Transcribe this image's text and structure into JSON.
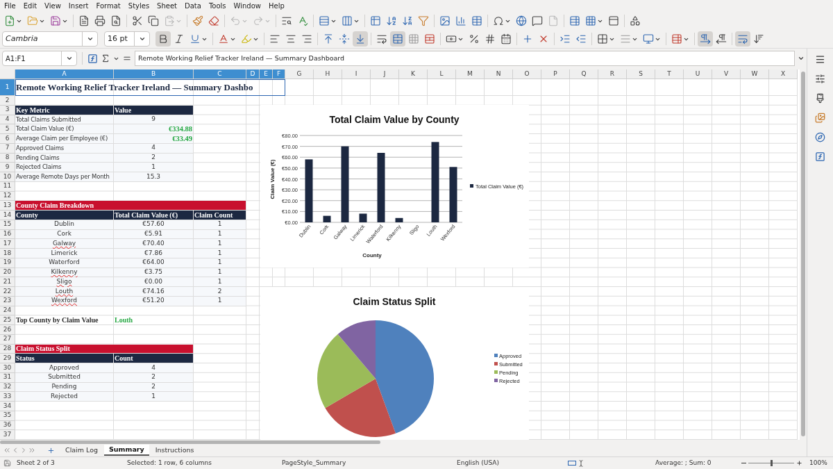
{
  "menu": [
    "File",
    "Edit",
    "View",
    "Insert",
    "Format",
    "Styles",
    "Sheet",
    "Data",
    "Tools",
    "Window",
    "Help"
  ],
  "standard_toolbar": {
    "paste_enabled": false,
    "undo_enabled": false,
    "redo_enabled": false,
    "header_footer_enabled": false
  },
  "formatting_toolbar": {
    "font": "Cambria",
    "size": "16 pt",
    "bold": true,
    "italic": false,
    "underline": false,
    "align_bottom": true,
    "merge_and_center": true,
    "left_to_right": true,
    "wrap_text": true
  },
  "formula_bar": {
    "name_box": "A1:F1",
    "content": "Remote Working Relief Tracker Ireland — Summary Dashboard"
  },
  "columns": [
    {
      "label": "A",
      "selected": true
    },
    {
      "label": "B",
      "selected": true
    },
    {
      "label": "C",
      "selected": true
    },
    {
      "label": "D",
      "selected": true
    },
    {
      "label": "E",
      "selected": true
    },
    {
      "label": "F",
      "selected": true
    },
    {
      "label": "G",
      "selected": false
    },
    {
      "label": "H",
      "selected": false
    },
    {
      "label": "I",
      "selected": false
    },
    {
      "label": "J",
      "selected": false
    },
    {
      "label": "K",
      "selected": false
    },
    {
      "label": "L",
      "selected": false
    },
    {
      "label": "M",
      "selected": false
    },
    {
      "label": "N",
      "selected": false
    },
    {
      "label": "O",
      "selected": false
    },
    {
      "label": "P",
      "selected": false
    },
    {
      "label": "Q",
      "selected": false
    },
    {
      "label": "R",
      "selected": false
    },
    {
      "label": "S",
      "selected": false
    },
    {
      "label": "T",
      "selected": false
    },
    {
      "label": "U",
      "selected": false
    },
    {
      "label": "V",
      "selected": false
    },
    {
      "label": "W",
      "selected": false
    },
    {
      "label": "X",
      "selected": false
    }
  ],
  "rows": [
    {
      "number": "1",
      "selected": true,
      "kind": "title",
      "text": "Remote Working Relief Tracker Ireland — Summary Dashbo"
    },
    {
      "number": "2",
      "selected": false,
      "kind": "blank"
    },
    {
      "number": "3",
      "selected": false,
      "kind": "header",
      "cells": [
        "Key Metric",
        "Value"
      ]
    },
    {
      "number": "4",
      "selected": false,
      "kind": "metric",
      "cells": [
        {
          "text": "Total Claims Submitted",
          "kind": "text"
        },
        {
          "text": "9",
          "kind": "number"
        }
      ]
    },
    {
      "number": "5",
      "selected": false,
      "kind": "metric",
      "cells": [
        {
          "text": "Total Claim Value (€)",
          "kind": "text"
        },
        {
          "text": "€334.88",
          "kind": "money"
        }
      ]
    },
    {
      "number": "6",
      "selected": false,
      "kind": "metric",
      "cells": [
        {
          "text": "Average Claim per Employee (€)",
          "kind": "text"
        },
        {
          "text": "€33.49",
          "kind": "money"
        }
      ]
    },
    {
      "number": "7",
      "selected": false,
      "kind": "metric",
      "cells": [
        {
          "text": "Approved Claims",
          "kind": "text"
        },
        {
          "text": "4",
          "kind": "number"
        }
      ]
    },
    {
      "number": "8",
      "selected": false,
      "kind": "metric",
      "cells": [
        {
          "text": "Pending Claims",
          "kind": "text"
        },
        {
          "text": "2",
          "kind": "number"
        }
      ]
    },
    {
      "number": "9",
      "selected": false,
      "kind": "metric",
      "cells": [
        {
          "text": "Rejected Claims",
          "kind": "text"
        },
        {
          "text": "1",
          "kind": "number"
        }
      ]
    },
    {
      "number": "10",
      "selected": false,
      "kind": "metric",
      "cells": [
        {
          "text": "Average Remote Days per Month",
          "kind": "text"
        },
        {
          "text": "15.3",
          "kind": "number"
        }
      ]
    },
    {
      "number": "11",
      "selected": false,
      "kind": "blank"
    },
    {
      "number": "12",
      "selected": false,
      "kind": "blank"
    },
    {
      "number": "13",
      "selected": false,
      "kind": "section",
      "text": "County Claim Breakdown"
    },
    {
      "number": "14",
      "selected": false,
      "kind": "header",
      "cells": [
        "County",
        "Total Claim Value (€)",
        "Claim Count"
      ]
    },
    {
      "number": "15",
      "selected": false,
      "kind": "list",
      "cells": [
        {
          "text": "Dublin",
          "misspelled": false
        },
        {
          "text": "€57.60",
          "misspelled": false
        },
        {
          "text": "1",
          "misspelled": false
        }
      ]
    },
    {
      "number": "16",
      "selected": false,
      "kind": "list",
      "cells": [
        {
          "text": "Cork",
          "misspelled": false
        },
        {
          "text": "€5.91",
          "misspelled": false
        },
        {
          "text": "1",
          "misspelled": false
        }
      ]
    },
    {
      "number": "17",
      "selected": false,
      "kind": "list",
      "cells": [
        {
          "text": "Galway",
          "misspelled": true
        },
        {
          "text": "€70.40",
          "misspelled": false
        },
        {
          "text": "1",
          "misspelled": false
        }
      ]
    },
    {
      "number": "18",
      "selected": false,
      "kind": "list",
      "cells": [
        {
          "text": "Limerick",
          "misspelled": false
        },
        {
          "text": "€7.86",
          "misspelled": false
        },
        {
          "text": "1",
          "misspelled": false
        }
      ]
    },
    {
      "number": "19",
      "selected": false,
      "kind": "list",
      "cells": [
        {
          "text": "Waterford",
          "misspelled": false
        },
        {
          "text": "€64.00",
          "misspelled": false
        },
        {
          "text": "1",
          "misspelled": false
        }
      ]
    },
    {
      "number": "20",
      "selected": false,
      "kind": "list",
      "cells": [
        {
          "text": "Kilkenny",
          "misspelled": true
        },
        {
          "text": "€3.75",
          "misspelled": false
        },
        {
          "text": "1",
          "misspelled": false
        }
      ]
    },
    {
      "number": "21",
      "selected": false,
      "kind": "list",
      "cells": [
        {
          "text": "Sligo",
          "misspelled": true
        },
        {
          "text": "€0.00",
          "misspelled": false
        },
        {
          "text": "1",
          "misspelled": false
        }
      ]
    },
    {
      "number": "22",
      "selected": false,
      "kind": "list",
      "cells": [
        {
          "text": "Louth",
          "misspelled": true
        },
        {
          "text": "€74.16",
          "misspelled": false
        },
        {
          "text": "2",
          "misspelled": false
        }
      ]
    },
    {
      "number": "23",
      "selected": false,
      "kind": "list",
      "cells": [
        {
          "text": "Wexford",
          "misspelled": true
        },
        {
          "text": "€51.20",
          "misspelled": false
        },
        {
          "text": "1",
          "misspelled": false
        }
      ]
    },
    {
      "number": "24",
      "selected": false,
      "kind": "blank"
    },
    {
      "number": "25",
      "selected": false,
      "kind": "label_value",
      "cells": [
        "Top County by Claim Value",
        "Louth"
      ]
    },
    {
      "number": "26",
      "selected": false,
      "kind": "blank"
    },
    {
      "number": "27",
      "selected": false,
      "kind": "blank"
    },
    {
      "number": "28",
      "selected": false,
      "kind": "section",
      "text": "Claim Status Split"
    },
    {
      "number": "29",
      "selected": false,
      "kind": "header",
      "cells": [
        "Status",
        "Count"
      ]
    },
    {
      "number": "30",
      "selected": false,
      "kind": "list",
      "cells": [
        {
          "text": "Approved",
          "misspelled": false
        },
        {
          "text": "4",
          "misspelled": false
        }
      ]
    },
    {
      "number": "31",
      "selected": false,
      "kind": "list",
      "cells": [
        {
          "text": "Submitted",
          "misspelled": false
        },
        {
          "text": "2",
          "misspelled": false
        }
      ]
    },
    {
      "number": "32",
      "selected": false,
      "kind": "list",
      "cells": [
        {
          "text": "Pending",
          "misspelled": false
        },
        {
          "text": "2",
          "misspelled": false
        }
      ]
    },
    {
      "number": "33",
      "selected": false,
      "kind": "list",
      "cells": [
        {
          "text": "Rejected",
          "misspelled": false
        },
        {
          "text": "1",
          "misspelled": false
        }
      ]
    },
    {
      "number": "34",
      "selected": false,
      "kind": "blank"
    },
    {
      "number": "35",
      "selected": false,
      "kind": "blank"
    },
    {
      "number": "36",
      "selected": false,
      "kind": "blank"
    },
    {
      "number": "37",
      "selected": false,
      "kind": "blank"
    }
  ],
  "charts": [
    {
      "chart_data": {
        "type": "bar",
        "title": "Total Claim Value by County",
        "xlabel": "County",
        "ylabel": "Claim Value (€)",
        "categories": [
          "Dublin",
          "Cork",
          "Galway",
          "Limerick",
          "Waterford",
          "Kilkenny",
          "Sligo",
          "Louth",
          "Wexford"
        ],
        "series": [
          {
            "name": "Total Claim Value (€)",
            "color": "#1c2841",
            "values": [
              58,
              6,
              70,
              8,
              64,
              4,
              0,
              74,
              51
            ]
          }
        ],
        "ylim": [
          0,
          80
        ],
        "grid": true,
        "legend": "right",
        "yticks": [
          {
            "value": 0,
            "label": "€0.00"
          },
          {
            "value": 10,
            "label": "€10.00"
          },
          {
            "value": 20,
            "label": "€20.00"
          },
          {
            "value": 30,
            "label": "€30.00"
          },
          {
            "value": 40,
            "label": "€40.00"
          },
          {
            "value": 50,
            "label": "€50.00"
          },
          {
            "value": 60,
            "label": "€60.00"
          },
          {
            "value": 70,
            "label": "€70.00"
          },
          {
            "value": 80,
            "label": "€80.00"
          }
        ]
      }
    },
    {
      "chart_data": {
        "type": "pie",
        "title": "Claim Status Split",
        "categories": [
          "Approved",
          "Submitted",
          "Pending",
          "Rejected"
        ],
        "colors": [
          "#4f81bd",
          "#c0504d",
          "#9bbb59",
          "#8064a2"
        ],
        "legend": "right",
        "series": [
          {
            "values": [
              44.4,
              22.2,
              22.2,
              11.2
            ]
          }
        ]
      }
    }
  ],
  "sheet_tabs": [
    {
      "label": "Claim Log",
      "selected": false
    },
    {
      "label": "Summary",
      "selected": true
    },
    {
      "label": "Instructions",
      "selected": false
    }
  ],
  "status_bar": {
    "sheet": "Sheet 2 of 3",
    "selection": "Selected: 1 row, 6 columns",
    "page_style": "PageStyle_Summary",
    "language": "English (USA)",
    "summary": "Average: ; Sum: 0",
    "zoom": "100%",
    "level": 0.5
  }
}
